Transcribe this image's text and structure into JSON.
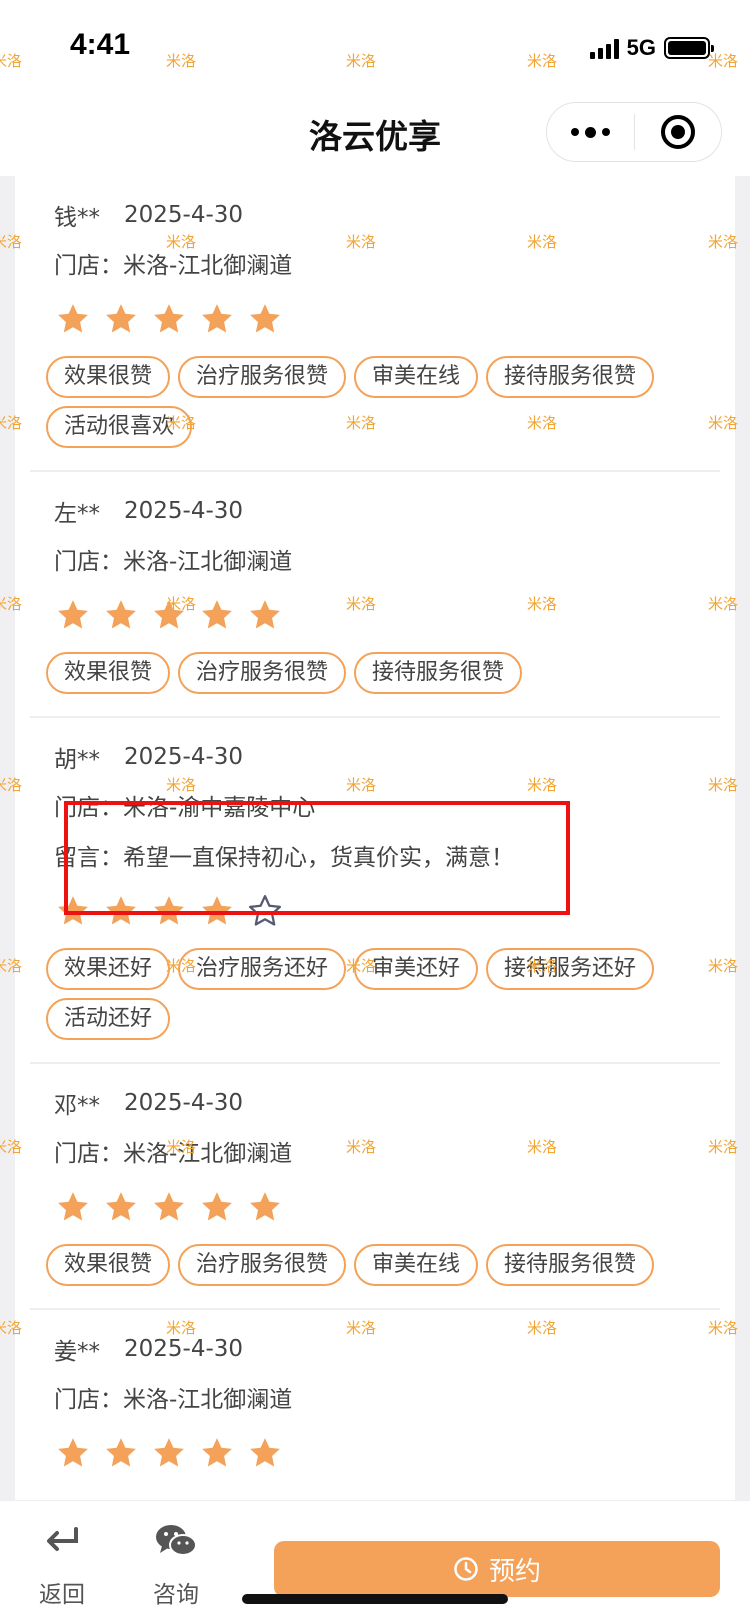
{
  "status_bar": {
    "time": "4:41",
    "network": "5G"
  },
  "nav": {
    "title": "洛云优享"
  },
  "store_prefix": "门店：",
  "message_prefix": "留言：",
  "reviews": [
    {
      "name": "钱**",
      "date": "2025-4-30",
      "store": "米洛-江北御澜道",
      "rating": 5,
      "tags": [
        "效果很赞",
        "治疗服务很赞",
        "审美在线",
        "接待服务很赞",
        "活动很喜欢"
      ]
    },
    {
      "name": "左**",
      "date": "2025-4-30",
      "store": "米洛-江北御澜道",
      "rating": 5,
      "tags": [
        "效果很赞",
        "治疗服务很赞",
        "接待服务很赞"
      ]
    },
    {
      "name": "胡**",
      "date": "2025-4-30",
      "store": "米洛-渝中嘉陵中心",
      "message": "希望一直保持初心，货真价实，满意！",
      "rating": 4,
      "tags": [
        "效果还好",
        "治疗服务还好",
        "审美还好",
        "接待服务还好",
        "活动还好"
      ]
    },
    {
      "name": "邓**",
      "date": "2025-4-30",
      "store": "米洛-江北御澜道",
      "rating": 5,
      "tags": [
        "效果很赞",
        "治疗服务很赞",
        "审美在线",
        "接待服务很赞"
      ]
    },
    {
      "name": "姜**",
      "date": "2025-4-30",
      "store": "米洛-江北御澜道",
      "rating": 5,
      "tags": []
    }
  ],
  "watermark": {
    "text": "米洛"
  },
  "bottom_bar": {
    "back_label": "返回",
    "consult_label": "咨询",
    "book_label": "预约"
  },
  "colors": {
    "accent": "#f4a259",
    "highlight": "#ee1111",
    "watermark": "#f2a535"
  }
}
